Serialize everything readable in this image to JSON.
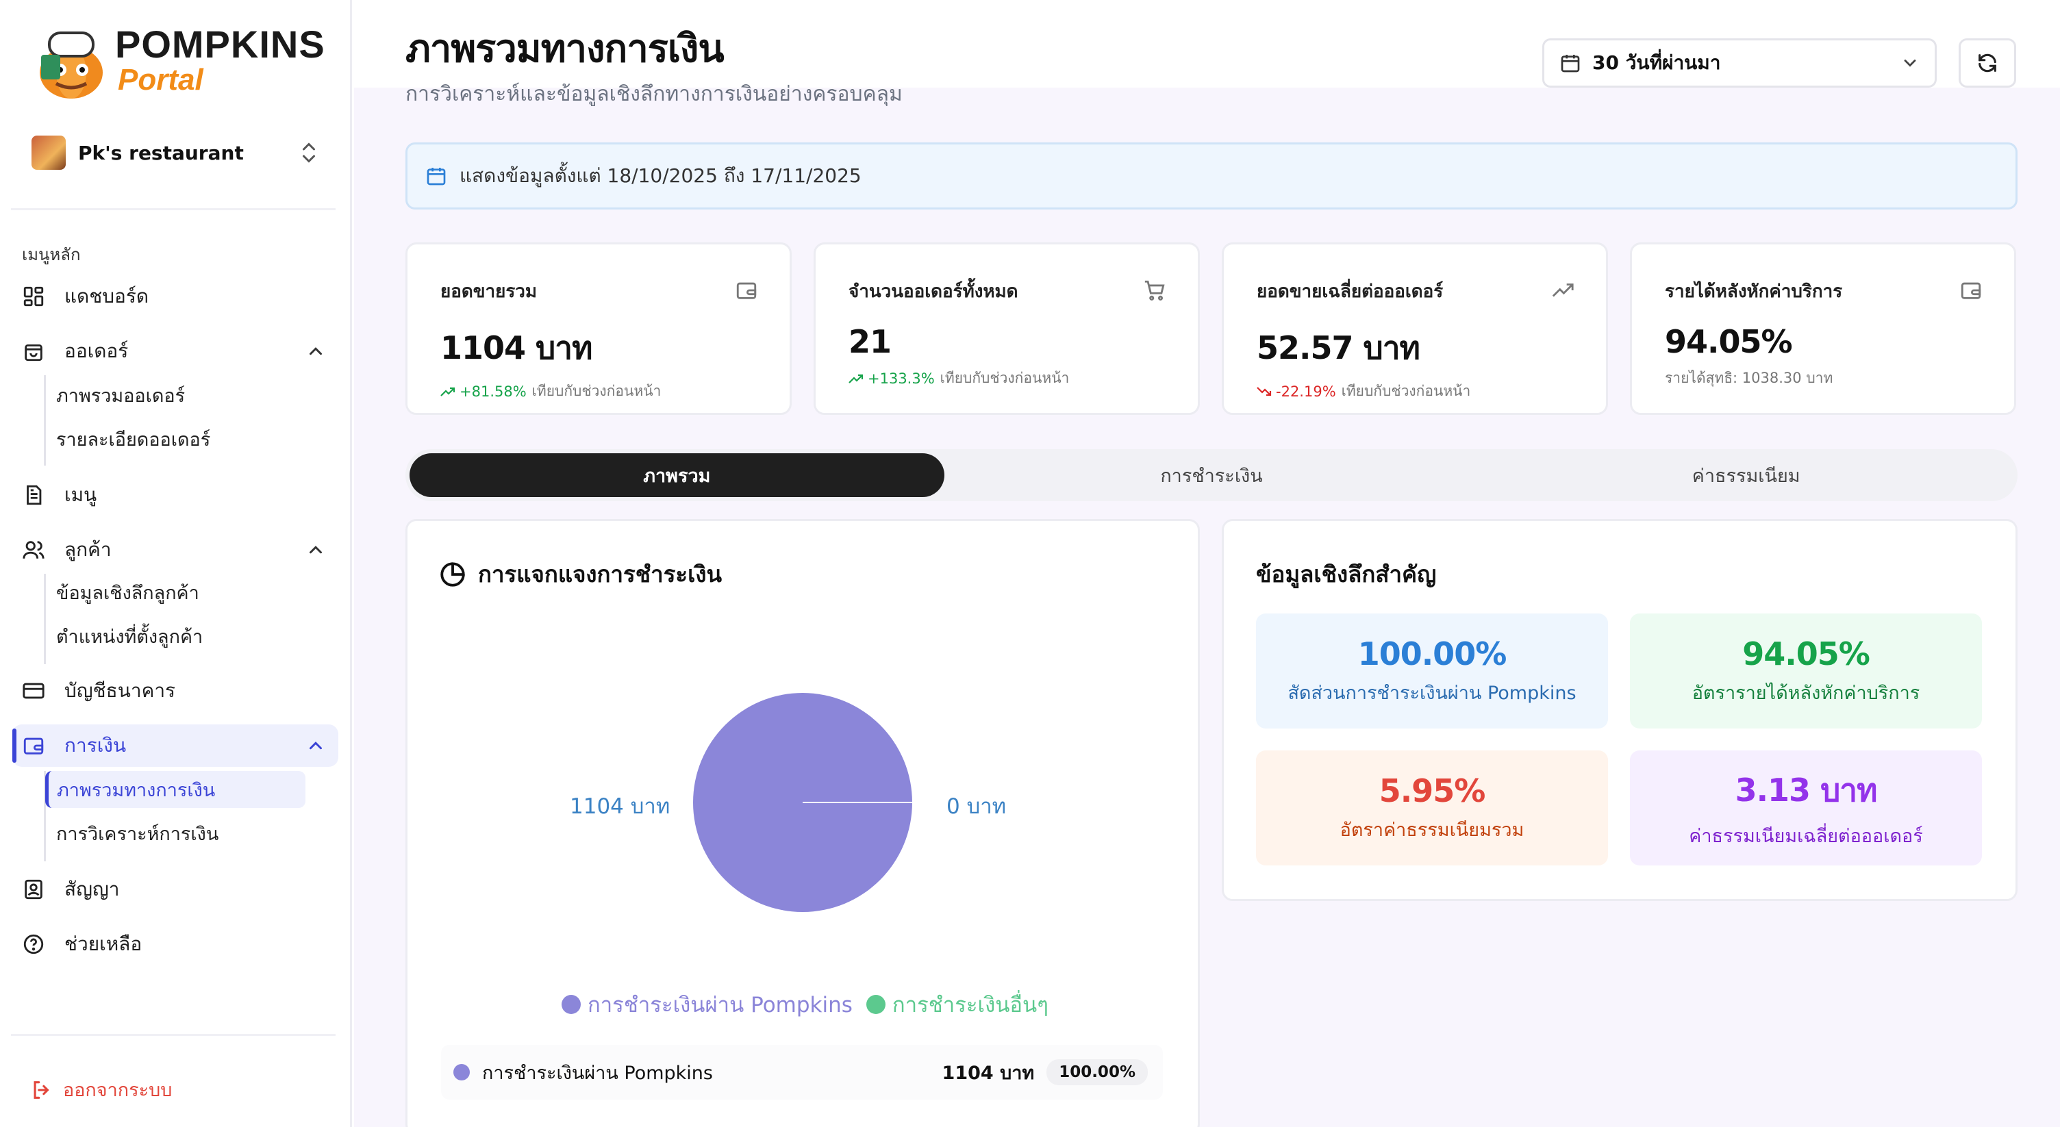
{
  "brand": {
    "line1": "POMPKINS",
    "line2": "Portal"
  },
  "restaurant": {
    "name": "Pk's restaurant"
  },
  "sidebar": {
    "section_label": "เมนูหลัก",
    "items": [
      {
        "label": "แดชบอร์ด"
      },
      {
        "label": "ออเดอร์",
        "children": [
          "ภาพรวมออเดอร์",
          "รายละเอียดออเดอร์"
        ]
      },
      {
        "label": "เมนู"
      },
      {
        "label": "ลูกค้า",
        "children": [
          "ข้อมูลเชิงลึกลูกค้า",
          "ตำแหน่งที่ตั้งลูกค้า"
        ]
      },
      {
        "label": "บัญชีธนาคาร"
      },
      {
        "label": "การเงิน",
        "children": [
          "ภาพรวมทางการเงิน",
          "การวิเคราะห์การเงิน"
        ]
      },
      {
        "label": "สัญญา"
      },
      {
        "label": "ช่วยเหลือ"
      }
    ],
    "logout": "ออกจากระบบ"
  },
  "header": {
    "title": "ภาพรวมทางการเงิน",
    "subtitle": "การวิเคราะห์และข้อมูลเชิงลึกทางการเงินอย่างครอบคลุม",
    "period": "30 วันที่ผ่านมา"
  },
  "date_banner": "แสดงข้อมูลตั้งแต่ 18/10/2025 ถึง 17/11/2025",
  "kpis": [
    {
      "title": "ยอดขายรวม",
      "value": "1104 บาท",
      "change": "+81.58%",
      "note": "เทียบกับช่วงก่อนหน้า",
      "trend": "up"
    },
    {
      "title": "จำนวนออเดอร์ทั้งหมด",
      "value": "21",
      "change": "+133.3%",
      "note": "เทียบกับช่วงก่อนหน้า",
      "trend": "up"
    },
    {
      "title": "ยอดขายเฉลี่ยต่อออเดอร์",
      "value": "52.57 บาท",
      "change": "-22.19%",
      "note": "เทียบกับช่วงก่อนหน้า",
      "trend": "down"
    },
    {
      "title": "รายได้หลังหักค่าบริการ",
      "value": "94.05%",
      "note": "รายได้สุทธิ: 1038.30 บาท"
    }
  ],
  "tabs": [
    "ภาพรวม",
    "การชำระเงิน",
    "ค่าธรรมเนียม"
  ],
  "payment_card": {
    "title": "การแจกแจงการชำระเงิน",
    "pie_left_label": "1104 บาท",
    "pie_right_label": "0 บาท",
    "legend": [
      "การชำระเงินผ่าน Pompkins",
      "การชำระเงินอื่นๆ"
    ],
    "rows": [
      {
        "label": "การชำระเงินผ่าน Pompkins",
        "amount": "1104 บาท",
        "percent": "100.00%"
      }
    ]
  },
  "insights_card": {
    "title": "ข้อมูลเชิงลึกสำคัญ",
    "items": [
      {
        "value": "100.00%",
        "label": "สัดส่วนการชำระเงินผ่าน Pompkins"
      },
      {
        "value": "94.05%",
        "label": "อัตรารายได้หลังหักค่าบริการ"
      },
      {
        "value": "5.95%",
        "label": "อัตราค่าธรรมเนียมรวม"
      },
      {
        "value": "3.13 บาท",
        "label": "ค่าธรรมเนียมเฉลี่ยต่อออเดอร์"
      }
    ]
  },
  "colors": {
    "accent": "#3b44d6",
    "pie_pompkins": "#8b86d9",
    "pie_other": "#5cc98e",
    "positive": "#16a34a",
    "negative": "#dc2626"
  },
  "chart_data": {
    "type": "pie",
    "categories": [
      "การชำระเงินผ่าน Pompkins",
      "การชำระเงินอื่นๆ"
    ],
    "values": [
      1104,
      0
    ],
    "title": "การแจกแจงการชำระเงิน"
  }
}
